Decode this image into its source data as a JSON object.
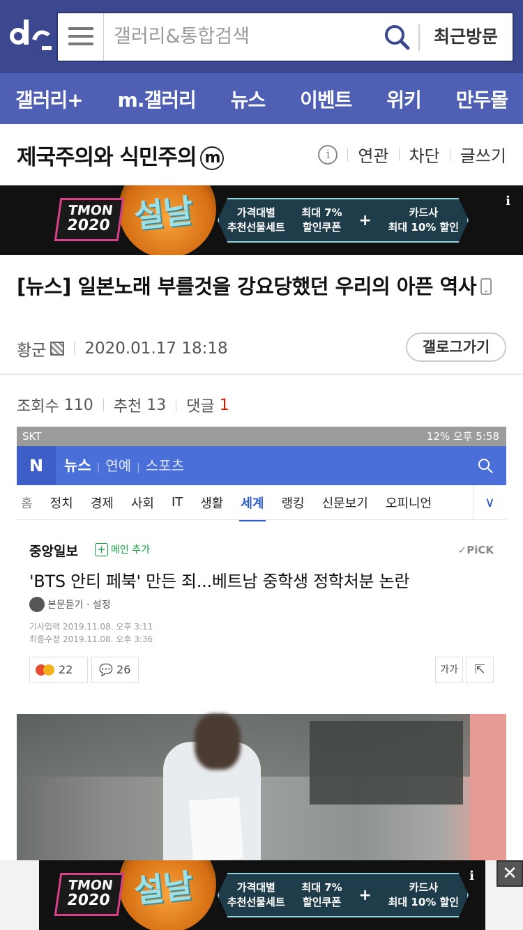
{
  "header": {
    "search_placeholder": "갤러리&통합검색",
    "recent_label": "최근방문"
  },
  "nav": {
    "items": [
      "갤러리+",
      "m.갤러리",
      "뉴스",
      "이벤트",
      "위키",
      "만두몰"
    ]
  },
  "gallery": {
    "name": "제국주의와 식민주의",
    "badge": "m",
    "info_icon": "i",
    "actions": [
      "연관",
      "차단",
      "글쓰기"
    ]
  },
  "ad": {
    "brand_line1": "TMON",
    "brand_line2": "2020",
    "title": "설날",
    "col1_line1": "가격대별",
    "col1_line2": "추천선물세트",
    "col2_line1": "최대 7%",
    "col2_line2": "할인쿠폰",
    "plus": "+",
    "col3_line1": "카드사",
    "col3_line2": "최대 10% 할인",
    "info": "i"
  },
  "post": {
    "title": "[뉴스] 일본노래 부를것을 강요당했던 우리의 아픈 역사",
    "author": "황군",
    "datetime": "2020.01.17 18:18",
    "gallog_button": "갤로그가기",
    "views_label": "조회수",
    "views": "110",
    "recommend_label": "추천",
    "recommend": "13",
    "comments_label": "댓글",
    "comments": "1"
  },
  "embedded": {
    "status_left": "SKT",
    "status_right": "12% 오후 5:58",
    "app_logo": "N",
    "tabs": [
      "뉴스",
      "연예",
      "스포츠"
    ],
    "categories_cut": "홈",
    "categories": [
      "정치",
      "경제",
      "사회",
      "IT",
      "생활",
      "세계",
      "랭킹",
      "신문보기",
      "오피니언"
    ],
    "active_category": "세계",
    "more": "∨",
    "press": "중앙일보",
    "add_main": "메인 추가",
    "pick": "✓PiCK",
    "article_title": "'BTS 안티 페북' 만든 죄...베트남 중학생 정학처분 논란",
    "listen": "본문듣기 · 설정",
    "input_date": "기사입력  2019.11.08. 오후 3:11",
    "modified_date": "최종수정  2019.11.08. 오후 3:36",
    "reactions": "22",
    "comment_count": "26",
    "font_size_btn": "가가"
  },
  "close_label": "✕"
}
